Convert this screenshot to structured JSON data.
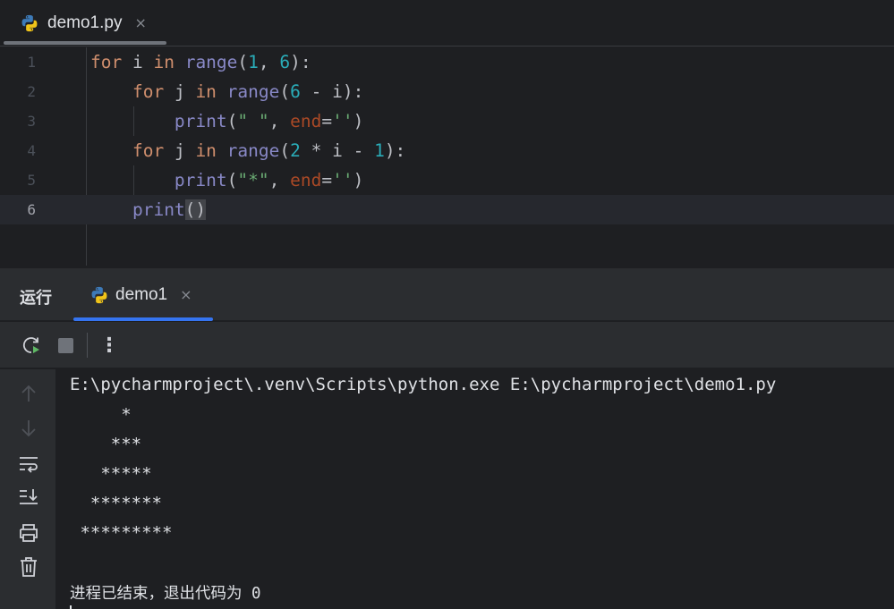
{
  "editor": {
    "tab": {
      "label": "demo1.py",
      "icon": "python-file-icon",
      "close": "×"
    },
    "lines": [
      {
        "n": "1",
        "tokens": [
          {
            "t": "for",
            "c": "kw"
          },
          {
            "t": " i ",
            "c": ""
          },
          {
            "t": "in",
            "c": "kw"
          },
          {
            "t": " ",
            "c": ""
          },
          {
            "t": "range",
            "c": "fn"
          },
          {
            "t": "(",
            "c": ""
          },
          {
            "t": "1",
            "c": "num"
          },
          {
            "t": ", ",
            "c": ""
          },
          {
            "t": "6",
            "c": "num"
          },
          {
            "t": "):",
            "c": ""
          }
        ]
      },
      {
        "n": "2",
        "tokens": [
          {
            "t": "    ",
            "c": ""
          },
          {
            "t": "for",
            "c": "kw"
          },
          {
            "t": " j ",
            "c": ""
          },
          {
            "t": "in",
            "c": "kw"
          },
          {
            "t": " ",
            "c": ""
          },
          {
            "t": "range",
            "c": "fn"
          },
          {
            "t": "(",
            "c": ""
          },
          {
            "t": "6",
            "c": "num"
          },
          {
            "t": " - i):",
            "c": ""
          }
        ]
      },
      {
        "n": "3",
        "tokens": [
          {
            "t": "        ",
            "c": ""
          },
          {
            "t": "print",
            "c": "fn"
          },
          {
            "t": "(",
            "c": ""
          },
          {
            "t": "\" \"",
            "c": "str"
          },
          {
            "t": ", ",
            "c": ""
          },
          {
            "t": "end",
            "c": "param"
          },
          {
            "t": "=",
            "c": ""
          },
          {
            "t": "''",
            "c": "str"
          },
          {
            "t": ")",
            "c": ""
          }
        ]
      },
      {
        "n": "4",
        "tokens": [
          {
            "t": "    ",
            "c": ""
          },
          {
            "t": "for",
            "c": "kw"
          },
          {
            "t": " j ",
            "c": ""
          },
          {
            "t": "in",
            "c": "kw"
          },
          {
            "t": " ",
            "c": ""
          },
          {
            "t": "range",
            "c": "fn"
          },
          {
            "t": "(",
            "c": ""
          },
          {
            "t": "2",
            "c": "num"
          },
          {
            "t": " * i - ",
            "c": ""
          },
          {
            "t": "1",
            "c": "num"
          },
          {
            "t": "):",
            "c": ""
          }
        ]
      },
      {
        "n": "5",
        "tokens": [
          {
            "t": "        ",
            "c": ""
          },
          {
            "t": "print",
            "c": "fn"
          },
          {
            "t": "(",
            "c": ""
          },
          {
            "t": "\"*\"",
            "c": "str"
          },
          {
            "t": ", ",
            "c": ""
          },
          {
            "t": "end",
            "c": "param"
          },
          {
            "t": "=",
            "c": ""
          },
          {
            "t": "''",
            "c": "str"
          },
          {
            "t": ")",
            "c": ""
          }
        ]
      },
      {
        "n": "6",
        "tokens": [
          {
            "t": "    ",
            "c": ""
          },
          {
            "t": "print",
            "c": "fn"
          },
          {
            "t": "()",
            "c": "brace-hl"
          }
        ]
      }
    ]
  },
  "run_panel": {
    "title": "运行",
    "tab": {
      "label": "demo1",
      "icon": "python-file-icon",
      "close": "×"
    },
    "toolbar": {
      "rerun": "rerun-icon",
      "stop": "stop-icon",
      "more": "⋮"
    },
    "side_tools": [
      "scroll-up-icon",
      "scroll-down-icon",
      "soft-wrap-icon",
      "scroll-to-end-icon",
      "print-icon",
      "trash-icon"
    ],
    "console": {
      "command": "E:\\pycharmproject\\.venv\\Scripts\\python.exe E:\\pycharmproject\\demo1.py",
      "output": [
        "     *",
        "    ***",
        "   *****",
        "  *******",
        " *********"
      ],
      "exit_message": "进程已结束，退出代码为 0"
    }
  },
  "colors": {
    "background": "#1e1f22",
    "panel": "#2b2d30",
    "accent": "#3574f0",
    "keyword": "#cf8e6d",
    "builtin": "#8888c6",
    "number": "#2aacb8",
    "string": "#6aab73",
    "param": "#aa4926"
  }
}
